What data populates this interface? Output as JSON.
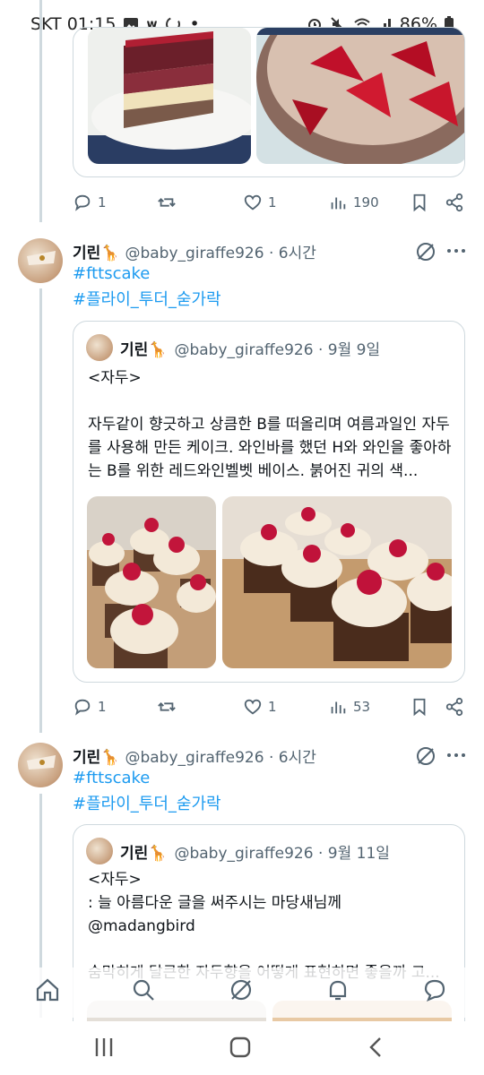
{
  "status_bar": {
    "carrier_time": "SKT 01:15",
    "dot": "•",
    "battery": "86%"
  },
  "tweet1_actions": {
    "replies": "1",
    "retweets": "",
    "likes": "1",
    "views": "190"
  },
  "tweet2": {
    "name": "기린🦒",
    "handle": "@baby_giraffe926 · 6시간",
    "hashtag1": "#fttscake",
    "hashtag2": "#플라이_투더_숟가락",
    "quote": {
      "name": "기린🦒",
      "handle": "@baby_giraffe926 · 9월 9일",
      "text": "<자두>\n\n자두같이 향긋하고 상큼한 B를 떠올리며 여름과일인 자두를 사용해 만든 케이크. 와인바를 했던 H와 와인을 좋아하는 B를 위한 레드와인벨벳 베이스. 붉어진 귀의 색..."
    },
    "actions": {
      "replies": "1",
      "likes": "1",
      "views": "53"
    }
  },
  "tweet3": {
    "name": "기린🦒",
    "handle": "@baby_giraffe926 · 6시간",
    "hashtag1": "#fttscake",
    "hashtag2": "#플라이_투더_숟가락",
    "quote": {
      "name": "기린🦒",
      "handle": "@baby_giraffe926 · 9월 11일",
      "text": "<자두>\n: 늘 아름다운 글을 써주시는 마당새님께\n@madangbird\n\n숨막히게 달큰한 자두향을 어떻게 표현하면 좋을까 고..."
    }
  },
  "icons": {
    "reply": "reply-icon",
    "retweet": "retweet-icon",
    "like": "heart-icon",
    "views": "views-icon",
    "bookmark": "bookmark-icon",
    "share": "share-icon",
    "grok": "grok-icon",
    "more": "more-icon"
  },
  "colors": {
    "link": "#1d9bf0",
    "secondary": "#536471",
    "border": "#cfd9de"
  }
}
